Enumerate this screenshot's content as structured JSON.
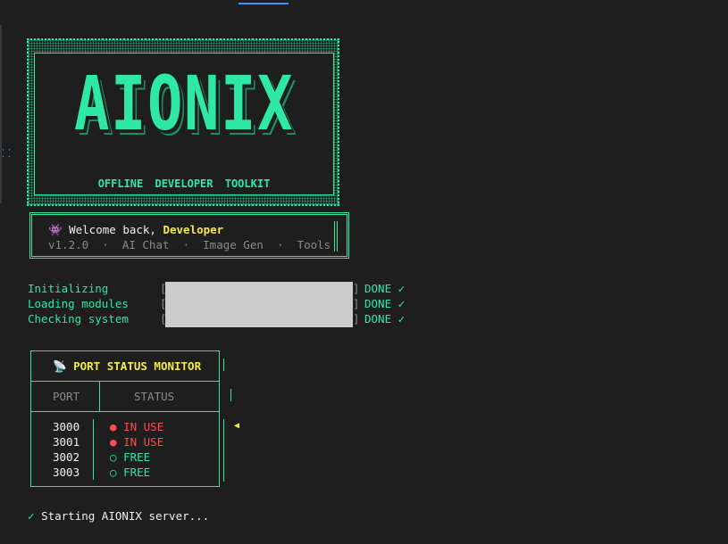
{
  "banner": {
    "logo_text": "AIONIX",
    "subtitle": "OFFLINE DEVELOPER TOOLKIT"
  },
  "welcome": {
    "icon": "space-invader-icon",
    "icon_glyph": "👾",
    "prefix": "Welcome back, ",
    "name": "Developer",
    "version": "v1.2.0",
    "sep": "·",
    "features": [
      "AI Chat",
      "Image Gen",
      "Tools"
    ]
  },
  "progress": [
    {
      "label": "Initializing",
      "status": "DONE ✓",
      "value": 1.0
    },
    {
      "label": "Loading modules",
      "status": "DONE ✓",
      "value": 1.0
    },
    {
      "label": "Checking system",
      "status": "DONE ✓",
      "value": 1.0
    }
  ],
  "ports": {
    "title_icon": "satellite-dish-icon",
    "title_glyph": "📡",
    "title": "PORT STATUS MONITOR",
    "col_port": "PORT",
    "col_status": "STATUS",
    "rows": [
      {
        "port": "3000",
        "bullet": "●",
        "status": "IN USE",
        "state": "in-use"
      },
      {
        "port": "3001",
        "bullet": "●",
        "status": "IN USE",
        "state": "in-use"
      },
      {
        "port": "3002",
        "bullet": "○",
        "status": "FREE",
        "state": "free"
      },
      {
        "port": "3003",
        "bullet": "○",
        "status": "FREE",
        "state": "free"
      }
    ],
    "pointer": "◀"
  },
  "final": {
    "check": "✓",
    "text": "Starting AIONIX server..."
  },
  "colors": {
    "background": "#1e1e1e",
    "accent": "#2ee8a4",
    "highlight": "#f5e94c",
    "in_use": "#ff4d4d",
    "progress_fill": "#cccccc"
  }
}
